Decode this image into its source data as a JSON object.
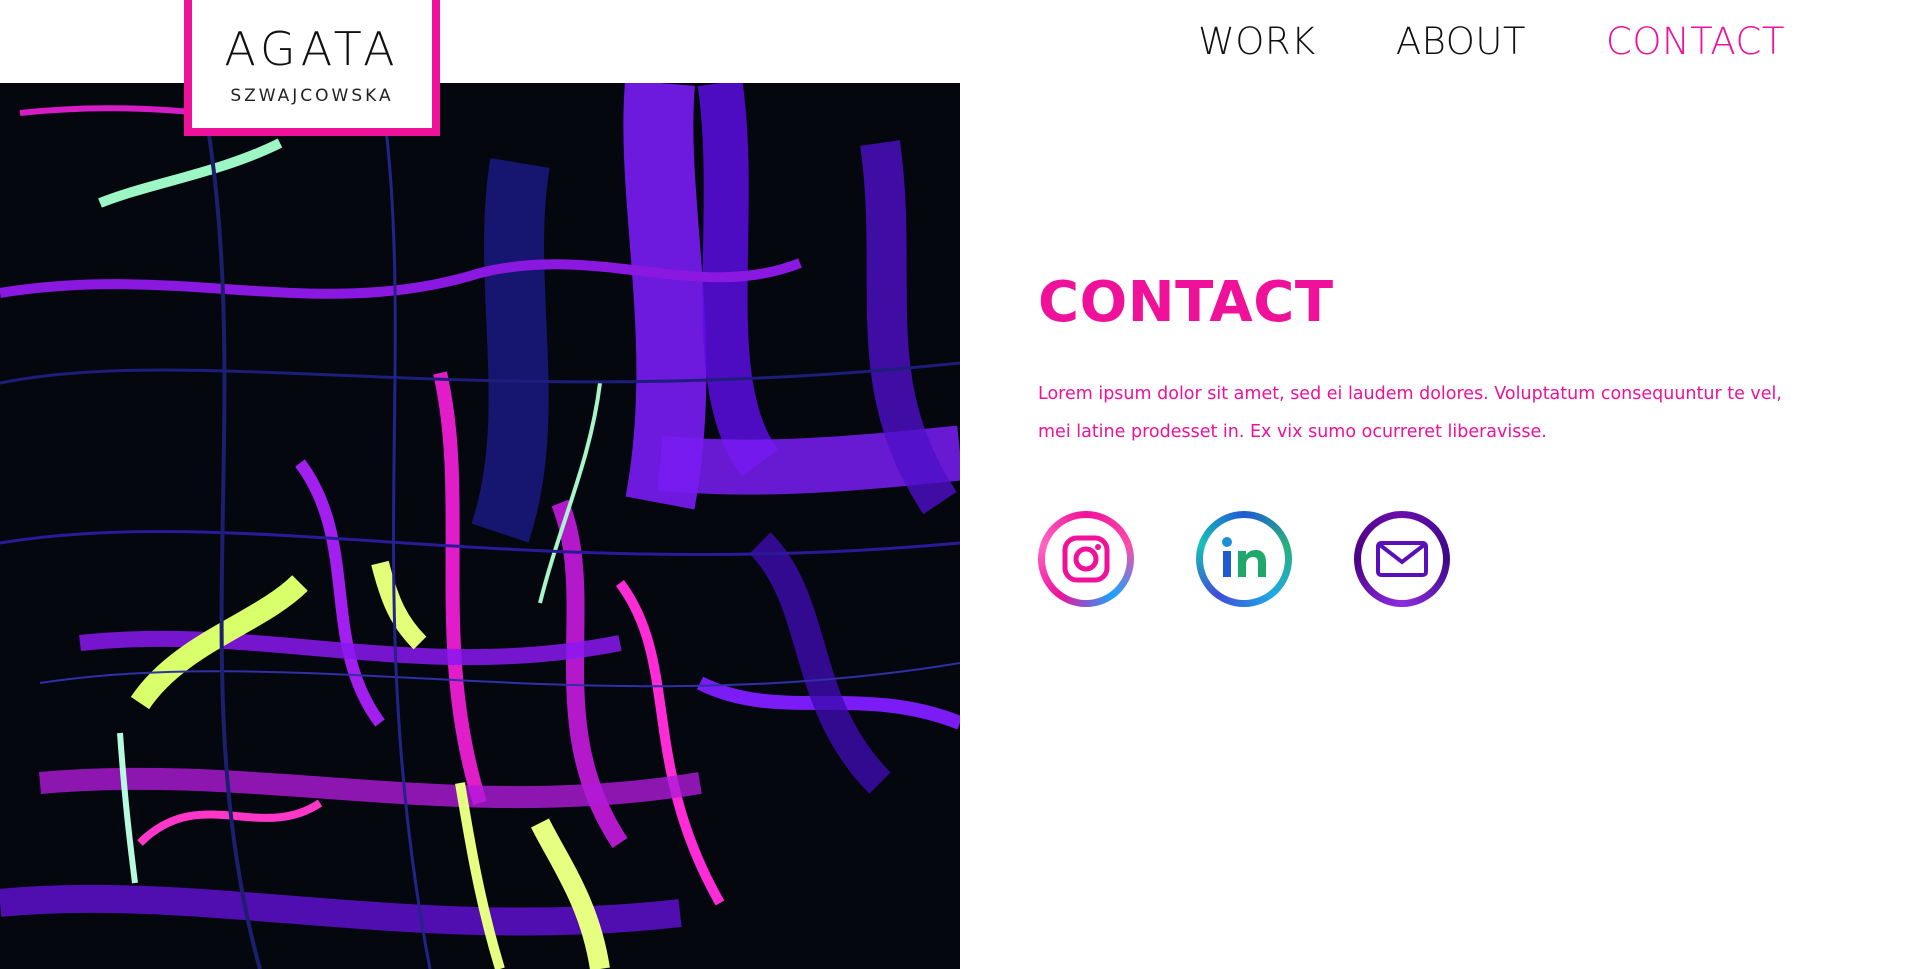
{
  "logo": {
    "name": "AGATA",
    "subtitle": "SZWAJCOWSKA"
  },
  "nav": {
    "items": [
      {
        "label": "WORK",
        "active": false
      },
      {
        "label": "ABOUT",
        "active": false
      },
      {
        "label": "CONTACT",
        "active": true
      }
    ]
  },
  "contact": {
    "heading": "CONTACT",
    "body": "Lorem ipsum dolor sit amet, sed ei laudem dolores. Voluptatum consequuntur te vel, mei latine prodesset in. Ex vix sumo ocurreret liberavisse."
  },
  "socials": [
    {
      "icon": "instagram-icon"
    },
    {
      "icon": "linkedin-icon"
    },
    {
      "icon": "mail-icon"
    }
  ],
  "colors": {
    "accent": "#f0119a",
    "text": "#111111",
    "art_background": "#05070f"
  }
}
